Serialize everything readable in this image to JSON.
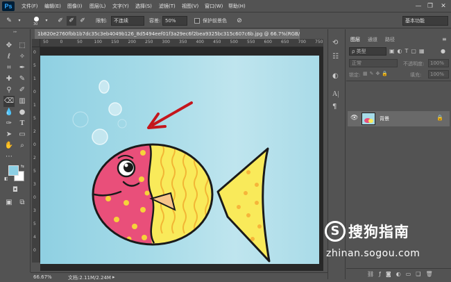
{
  "app": {
    "logo": "Ps"
  },
  "menu": [
    "文件(F)",
    "编辑(E)",
    "图像(I)",
    "图层(L)",
    "文字(Y)",
    "选择(S)",
    "滤镜(T)",
    "视图(V)",
    "窗口(W)",
    "帮助(H)"
  ],
  "window_controls": {
    "minimize": "—",
    "restore": "❐",
    "close": "✕"
  },
  "options": {
    "brush_size": "30",
    "limit_label": "限制:",
    "limit_value": "不连续",
    "tolerance_label": "容差:",
    "tolerance_value": "50%",
    "protect_label": "保护前景色",
    "workspace": "基本功能"
  },
  "document": {
    "tab_title": "1b820e2760fbb1b7dc35c3eb4049b126_8d5494eef01f3a29ec6f2bea9325bc315c607c6b.jpg @ 66.7%(RGB/8#) *",
    "close": "✕"
  },
  "ruler_top": [
    "50",
    "0",
    "50",
    "100",
    "150",
    "200",
    "250",
    "300",
    "350",
    "400",
    "450",
    "500",
    "550",
    "600",
    "650",
    "700",
    "750"
  ],
  "ruler_left": [
    "0",
    "5",
    "1",
    "0",
    "1",
    "5",
    "2",
    "0",
    "2",
    "5",
    "3",
    "0",
    "3",
    "5",
    "4",
    "0"
  ],
  "status": {
    "zoom": "66.67%",
    "doc": "文档:2.11M/2.24M"
  },
  "layers_panel": {
    "tabs": [
      "图层",
      "通道",
      "路径"
    ],
    "kind_label": "ρ 类型",
    "blend_mode": "正常",
    "opacity_label": "不透明度:",
    "opacity_value": "100%",
    "lock_label": "锁定:",
    "fill_label": "填充:",
    "fill_value": "100%",
    "layers": [
      {
        "name": "背景"
      }
    ]
  },
  "watermark": {
    "logo_char": "S",
    "brand": "搜狗指南",
    "url": "zhinan.sogou.com"
  },
  "colors": {
    "foreground": "#8ccfe4",
    "background": "#ffffff",
    "fish_red": "#e94f7a",
    "fish_yellow": "#f9ea5a",
    "arrow": "#c4161c"
  }
}
